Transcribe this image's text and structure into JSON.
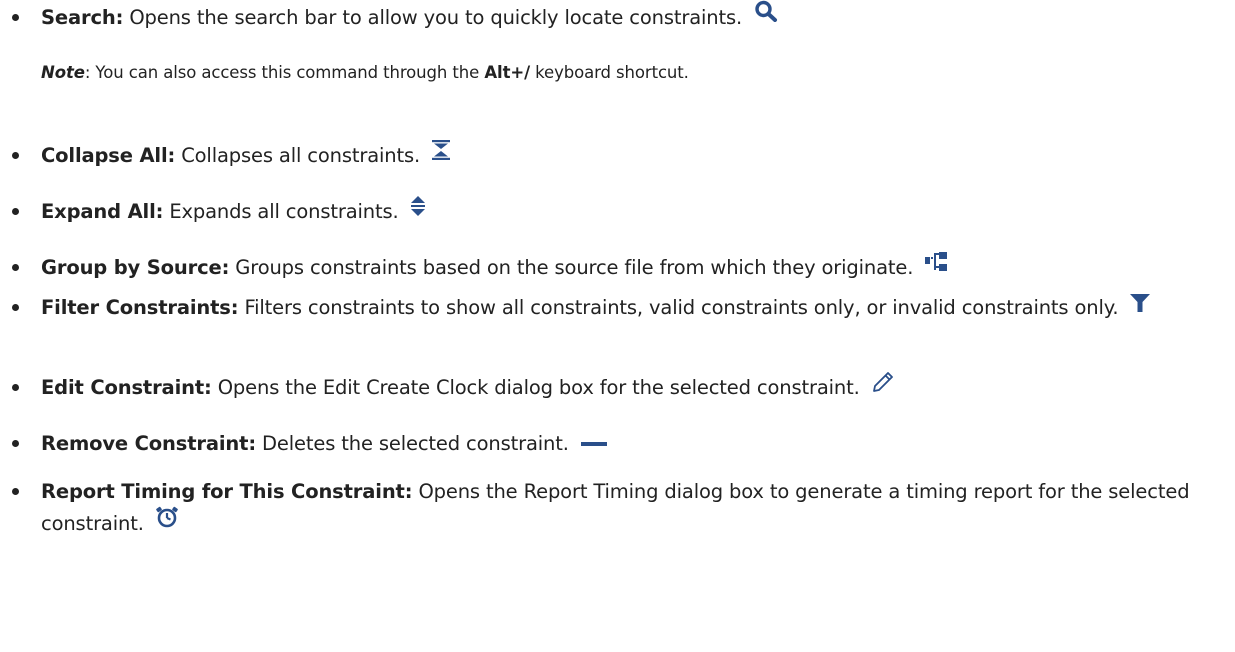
{
  "items": [
    {
      "label": "Search:",
      "description": "Opens the search bar to allow you to quickly locate constraints.",
      "icon": "search-icon"
    },
    {
      "label": "Collapse All:",
      "description": "Collapses all constraints.",
      "icon": "collapse-all-icon"
    },
    {
      "label": "Expand All:",
      "description": "Expands all constraints.",
      "icon": "expand-all-icon"
    },
    {
      "label": "Group by Source:",
      "description": "Groups constraints based on the source file from which they originate.",
      "icon": "group-by-source-icon"
    },
    {
      "label": "Filter Constraints:",
      "description": "Filters constraints to show all constraints, valid constraints only, or invalid constraints only.",
      "icon": "filter-icon"
    },
    {
      "label": "Edit Constraint:",
      "description": "Opens the Edit Create Clock dialog box for the selected constraint.",
      "icon": "pencil-icon"
    },
    {
      "label": "Remove Constraint:",
      "description": "Deletes the selected constraint.",
      "icon": "minus-icon"
    },
    {
      "label": "Report Timing for This Constraint:",
      "description": "Opens the Report Timing dialog box to generate a timing report for the selected constraint.",
      "icon": "stopwatch-icon"
    }
  ],
  "note": {
    "label": "Note",
    "text_before": ": You can also access this command through the ",
    "shortcut": "Alt+/",
    "text_after": " keyboard shortcut."
  },
  "colors": {
    "icon_blue": "#2a4f8a",
    "text": "#222222"
  }
}
